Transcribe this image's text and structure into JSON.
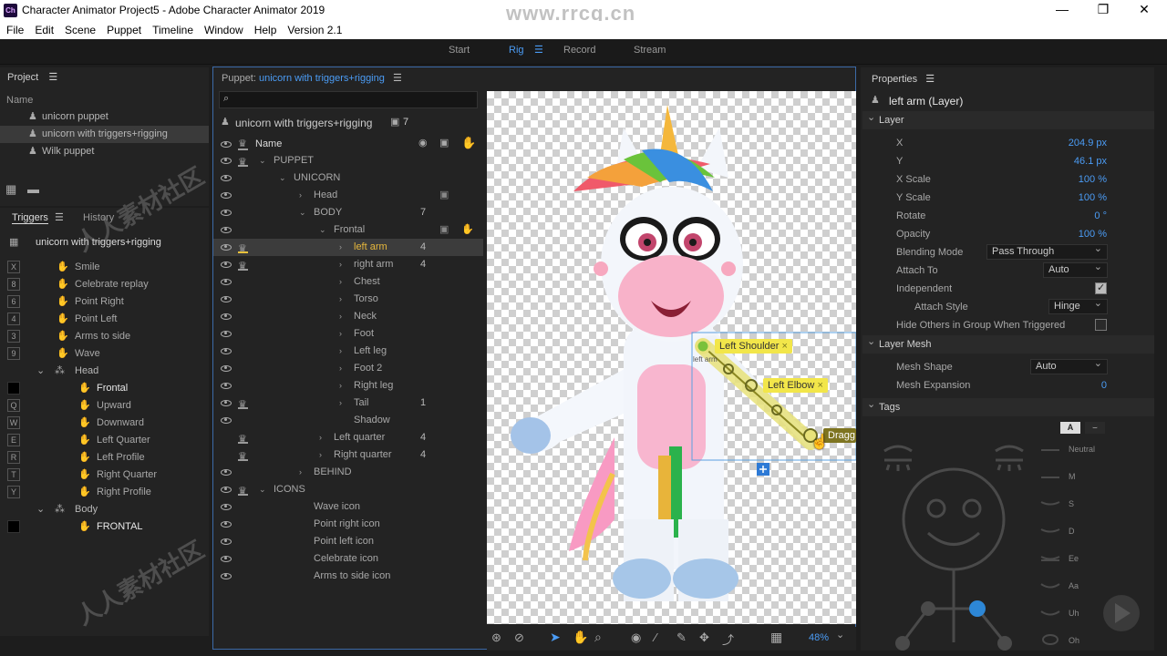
{
  "titlebar": {
    "title": "Character Animator Project5 - Adobe Character Animator 2019",
    "logo": "Ch",
    "minimize": "—",
    "restore": "❐",
    "close": "✕",
    "watermark": "www.rrcg.cn"
  },
  "menu": [
    "File",
    "Edit",
    "Scene",
    "Puppet",
    "Timeline",
    "Window",
    "Help",
    "Version 2.1"
  ],
  "workspaces": {
    "start": "Start",
    "rig": "Rig",
    "record": "Record",
    "stream": "Stream"
  },
  "project": {
    "title": "Project",
    "name_header": "Name",
    "items": [
      "unicorn puppet",
      "unicorn with triggers+rigging",
      "Wilk puppet"
    ]
  },
  "triggers": {
    "tab_triggers": "Triggers",
    "tab_history": "History",
    "puppet_name": "unicorn with triggers+rigging",
    "items": [
      {
        "key": "X",
        "label": "Smile"
      },
      {
        "key": "8",
        "label": "Celebrate replay"
      },
      {
        "key": "6",
        "label": "Point Right"
      },
      {
        "key": "4",
        "label": "Point Left"
      },
      {
        "key": "3",
        "label": "Arms to side"
      },
      {
        "key": "9",
        "label": "Wave"
      }
    ],
    "group_head": "Head",
    "head_items": [
      {
        "key": "",
        "label": "Frontal"
      },
      {
        "key": "Q",
        "label": "Upward"
      },
      {
        "key": "W",
        "label": "Downward"
      },
      {
        "key": "E",
        "label": "Left Quarter"
      },
      {
        "key": "R",
        "label": "Left Profile"
      },
      {
        "key": "T",
        "label": "Right Quarter"
      },
      {
        "key": "Y",
        "label": "Right Profile"
      }
    ],
    "group_body": "Body",
    "body_items": [
      {
        "key": "",
        "label": "FRONTAL"
      }
    ]
  },
  "puppet": {
    "prefix": "Puppet:",
    "name": "unicorn with triggers+rigging",
    "root_label": "unicorn with triggers+rigging",
    "root_count": "7",
    "col_name": "Name",
    "rows": [
      {
        "label": "PUPPET",
        "indent": 0,
        "arrow": "⌄",
        "crown": true,
        "count": ""
      },
      {
        "label": "UNICORN",
        "indent": 1,
        "arrow": "⌄",
        "crown": false,
        "count": ""
      },
      {
        "label": "Head",
        "indent": 2,
        "arrow": "›",
        "crown": false,
        "count": ""
      },
      {
        "label": "BODY",
        "indent": 2,
        "arrow": "⌄",
        "crown": false,
        "count": "7"
      },
      {
        "label": "Frontal",
        "indent": 3,
        "arrow": "⌄",
        "crown": false,
        "count": ""
      },
      {
        "label": "left arm",
        "indent": 4,
        "arrow": "›",
        "crown": true,
        "count": "4"
      },
      {
        "label": "right arm",
        "indent": 4,
        "arrow": "›",
        "crown": true,
        "count": "4"
      },
      {
        "label": "Chest",
        "indent": 4,
        "arrow": "›",
        "crown": false,
        "count": ""
      },
      {
        "label": "Torso",
        "indent": 4,
        "arrow": "›",
        "crown": false,
        "count": ""
      },
      {
        "label": "Neck",
        "indent": 4,
        "arrow": "›",
        "crown": false,
        "count": ""
      },
      {
        "label": "Foot",
        "indent": 4,
        "arrow": "›",
        "crown": false,
        "count": ""
      },
      {
        "label": "Left leg",
        "indent": 4,
        "arrow": "›",
        "crown": false,
        "count": ""
      },
      {
        "label": "Foot 2",
        "indent": 4,
        "arrow": "›",
        "crown": false,
        "count": ""
      },
      {
        "label": "Right leg",
        "indent": 4,
        "arrow": "›",
        "crown": false,
        "count": ""
      },
      {
        "label": "Tail",
        "indent": 4,
        "arrow": "›",
        "crown": true,
        "count": "1"
      },
      {
        "label": "Shadow",
        "indent": 4,
        "arrow": "",
        "crown": false,
        "count": ""
      },
      {
        "label": "Left quarter",
        "indent": 3,
        "arrow": "›",
        "crown": true,
        "count": "4"
      },
      {
        "label": "Right quarter",
        "indent": 3,
        "arrow": "›",
        "crown": true,
        "count": "4"
      },
      {
        "label": "BEHIND",
        "indent": 2,
        "arrow": "›",
        "crown": false,
        "count": ""
      },
      {
        "label": "ICONS",
        "indent": 0,
        "arrow": "⌄",
        "crown": true,
        "count": ""
      },
      {
        "label": "Wave icon",
        "indent": 2,
        "arrow": "",
        "crown": false,
        "count": ""
      },
      {
        "label": "Point right icon",
        "indent": 2,
        "arrow": "",
        "crown": false,
        "count": ""
      },
      {
        "label": "Point left icon",
        "indent": 2,
        "arrow": "",
        "crown": false,
        "count": ""
      },
      {
        "label": "Celebrate icon",
        "indent": 2,
        "arrow": "",
        "crown": false,
        "count": ""
      },
      {
        "label": "Arms to side icon",
        "indent": 2,
        "arrow": "",
        "crown": false,
        "count": ""
      }
    ]
  },
  "canvas": {
    "handle_shoulder": "Left Shoulder",
    "handle_elbow": "Left Elbow",
    "handle_dragger": "Dragg",
    "small_left_arm": "left arm",
    "zoom": "48%",
    "close": "×"
  },
  "properties": {
    "title": "Properties",
    "layer_name": "left arm (Layer)",
    "section_layer": "Layer",
    "x_label": "X",
    "x_value": "204.9 px",
    "y_label": "Y",
    "y_value": "46.1 px",
    "xscale_label": "X Scale",
    "xscale_value": "100 %",
    "yscale_label": "Y Scale",
    "yscale_value": "100 %",
    "rotate_label": "Rotate",
    "rotate_value": "0 °",
    "opacity_label": "Opacity",
    "opacity_value": "100 %",
    "blend_label": "Blending Mode",
    "blend_value": "Pass Through",
    "attach_label": "Attach To",
    "attach_value": "Auto",
    "independent_label": "Independent",
    "attach_style_label": "Attach Style",
    "attach_style_value": "Hinge",
    "hide_label": "Hide Others in Group When Triggered",
    "section_mesh": "Layer Mesh",
    "mesh_shape_label": "Mesh Shape",
    "mesh_shape_value": "Auto",
    "mesh_exp_label": "Mesh Expansion",
    "mesh_exp_value": "0",
    "section_tags": "Tags",
    "tag_btn_a": "A",
    "visemes": [
      "Neutral",
      "M",
      "S",
      "D",
      "Ee",
      "Aa",
      "Uh",
      "Oh"
    ]
  }
}
